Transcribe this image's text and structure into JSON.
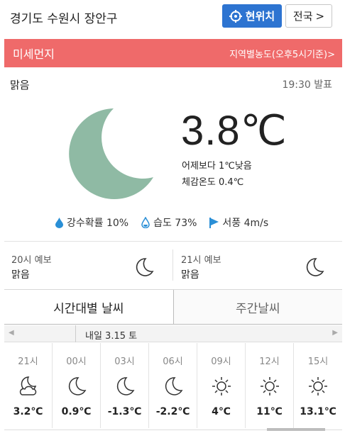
{
  "header": {
    "location": "경기도 수원시 장안구",
    "current_location_btn": "현위치",
    "nationwide_btn": "전국",
    "nationwide_arrow": ">"
  },
  "dust": {
    "title": "미세먼지",
    "link": "지역별농도(오후5시기준)",
    "link_arrow": ">"
  },
  "current": {
    "condition": "맑음",
    "announce_time": "19:30 발표",
    "temperature": "3.8℃",
    "compare": "어제보다 1℃낮음",
    "feels_like": "체감온도 0.4℃",
    "icon": "moon-icon"
  },
  "stats": [
    {
      "icon": "raindrop-icon",
      "label": "강수확률 10%"
    },
    {
      "icon": "humidity-icon",
      "label": "습도 73%"
    },
    {
      "icon": "wind-flag-icon",
      "label": "서풍 4m/s"
    }
  ],
  "forecast": [
    {
      "label": "20시 예보",
      "value": "맑음",
      "icon": "moon-icon"
    },
    {
      "label": "21시 예보",
      "value": "맑음",
      "icon": "moon-icon"
    }
  ],
  "tabs": {
    "hourly": "시간대별 날씨",
    "weekly": "주간날씨"
  },
  "date_bar": {
    "label": "내일 3.15 토"
  },
  "hourly": [
    {
      "time": "21시",
      "icon": "moon-cloud-icon",
      "temp": "3.2℃"
    },
    {
      "time": "00시",
      "icon": "moon-icon",
      "temp": "0.9℃"
    },
    {
      "time": "03시",
      "icon": "moon-icon",
      "temp": "-1.3℃"
    },
    {
      "time": "06시",
      "icon": "moon-icon",
      "temp": "-2.2℃"
    },
    {
      "time": "09시",
      "icon": "sun-icon",
      "temp": "4℃"
    },
    {
      "time": "12시",
      "icon": "sun-icon",
      "temp": "11℃"
    },
    {
      "time": "15시",
      "icon": "sun-icon",
      "temp": "13.1℃"
    }
  ],
  "colors": {
    "dust_bar": "#ef6a6a",
    "location_button": "#2d74d1",
    "moon": "#8fbaa4"
  }
}
